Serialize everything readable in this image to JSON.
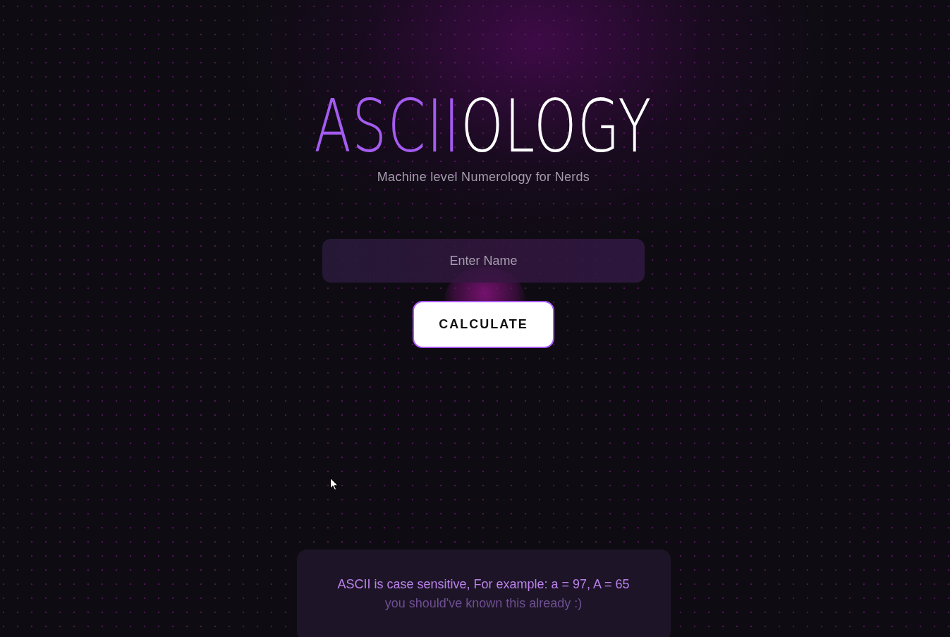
{
  "logo": {
    "accent": "ASCII",
    "rest": "OLOGY"
  },
  "tagline": "Machine level Numerology for Nerds",
  "name_field": {
    "placeholder": "Enter Name"
  },
  "calculate_button": {
    "label": "CALCULATE"
  },
  "note": {
    "text": "ASCII is case sensitive, For example: a = 97, A = 65",
    "subtext": "you should've known this already :)"
  }
}
